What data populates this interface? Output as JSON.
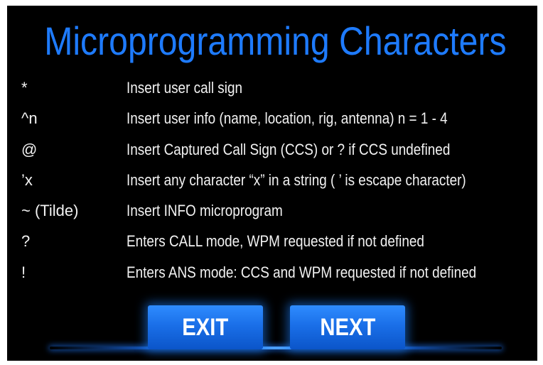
{
  "title": "Microprogramming Characters",
  "colors": {
    "title": "#1e7bff",
    "background": "#000000",
    "text": "#f2f2f2",
    "button": "#1a6fe8"
  },
  "rows": [
    {
      "char": "*",
      "desc": "Insert user call sign"
    },
    {
      "char": "^n",
      "desc": "Insert user info (name, location, rig, antenna) n = 1 - 4"
    },
    {
      "char": "@",
      "desc": "Insert Captured Call Sign (CCS) or ? if CCS undefined"
    },
    {
      "char": "’x",
      "desc": "Insert any character “x” in a string ( ’ is escape character)"
    },
    {
      "char": "~ (Tilde)",
      "desc": "Insert INFO microprogram"
    },
    {
      "char": "?",
      "desc": "Enters CALL mode, WPM requested if not defined"
    },
    {
      "char": "!",
      "desc": "Enters ANS mode: CCS and WPM requested if not defined"
    }
  ],
  "buttons": {
    "exit": "EXIT",
    "next": "NEXT"
  }
}
